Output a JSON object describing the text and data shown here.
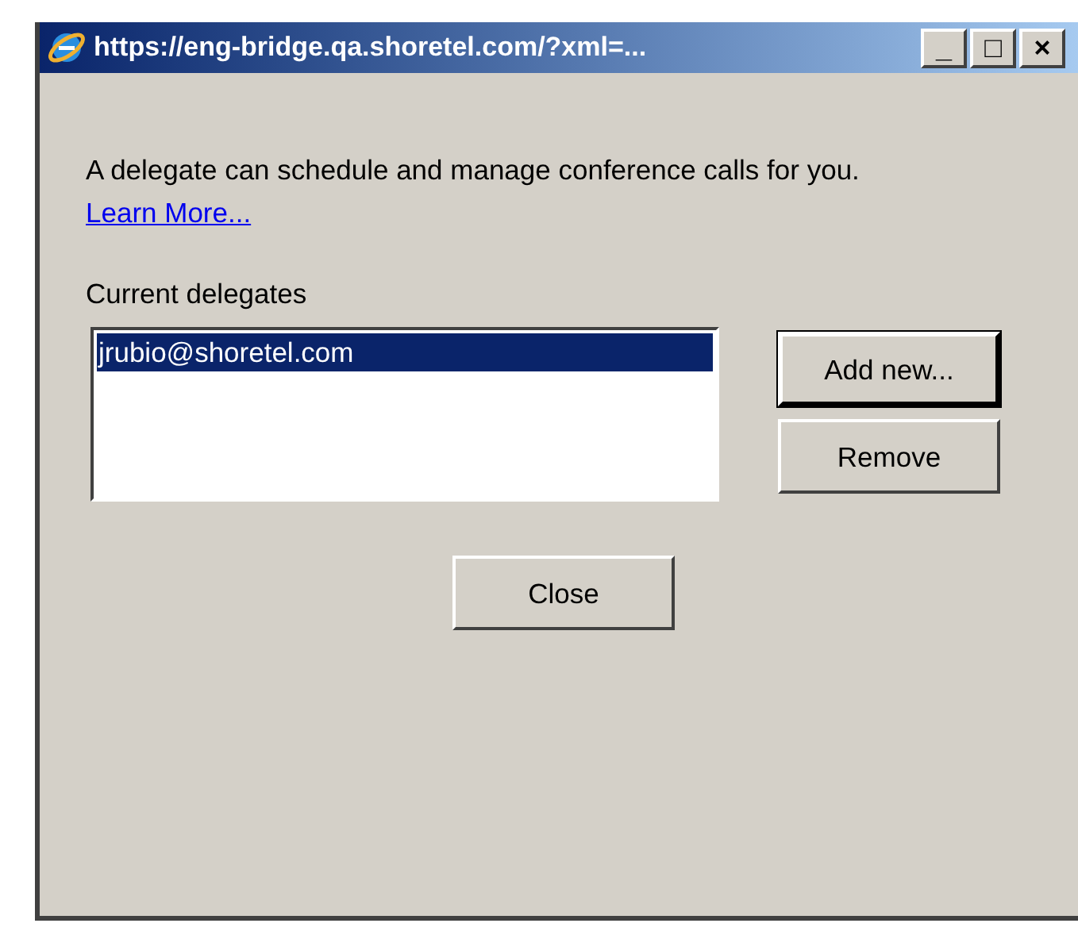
{
  "window": {
    "title": "https://eng-bridge.qa.shoretel.com/?xml=...",
    "controls": [
      "_",
      "□",
      "×"
    ]
  },
  "description": {
    "text": "A delegate can schedule and manage conference calls for you.",
    "link": "Learn More..."
  },
  "delegates_label": "Current delegates",
  "delegates": [
    {
      "email": "jrubio@shoretel.com",
      "selected": true
    }
  ],
  "side_buttons": [
    {
      "label": "Add new...",
      "default": true
    },
    {
      "label": "Remove",
      "default": false
    }
  ],
  "close_button": "Close"
}
